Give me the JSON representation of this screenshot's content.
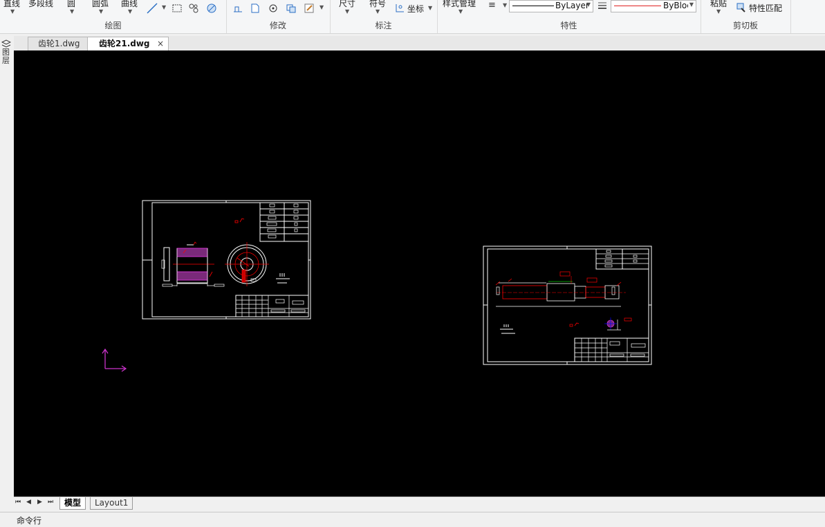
{
  "ribbon": {
    "draw": {
      "line_label": "直线",
      "polyline_label": "多段线",
      "circle_label": "圆",
      "arc_label": "圆弧",
      "curve_label": "曲线",
      "group_label": "绘图"
    },
    "modify": {
      "group_label": "修改"
    },
    "annotate": {
      "dimension_label": "尺寸",
      "symbol_label": "符号",
      "coordinate_label": "坐标",
      "group_label": "标注"
    },
    "properties": {
      "style_manager_label": "样式管理",
      "linetype_value": "ByLayer",
      "lineweight_value": "ByBlock",
      "group_label": "特性"
    },
    "clipboard": {
      "paste_label": "粘贴",
      "match_props_label": "特性匹配",
      "group_label": "剪切板"
    }
  },
  "doc_tabs": [
    {
      "label": "齿轮1.dwg",
      "active": false
    },
    {
      "label": "齿轮21.dwg",
      "active": true
    }
  ],
  "close_glyph": "×",
  "left_toolbar": {
    "label": "图层"
  },
  "layout_tabs": [
    {
      "label": "模型",
      "active": true
    },
    {
      "label": "Layout1",
      "active": false
    }
  ],
  "nav_glyphs": [
    "⏮",
    "◀",
    "▶",
    "⏭"
  ],
  "command_line_label": "命令行",
  "colors": {
    "canvas_bg": "#000000",
    "drawing_line": "#ffffff",
    "dimension_red": "#ff0000",
    "hatch_magenta": "#cc33cc",
    "ucs_magenta": "#cc33cc"
  }
}
